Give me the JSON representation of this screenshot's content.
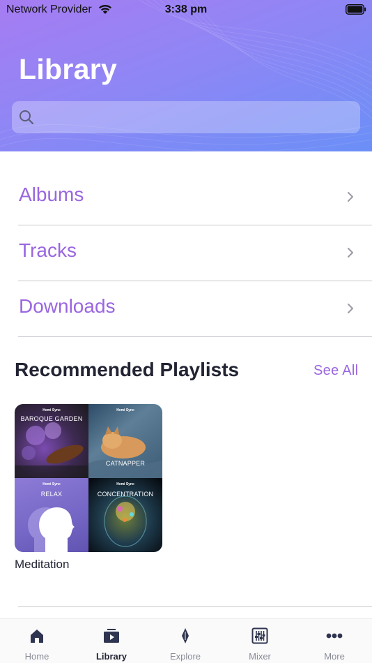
{
  "status_bar": {
    "carrier": "Network Provider",
    "time": "3:38 pm"
  },
  "header": {
    "title": "Library",
    "search_placeholder": ""
  },
  "library_items": [
    {
      "label": "Albums"
    },
    {
      "label": "Tracks"
    },
    {
      "label": "Downloads"
    }
  ],
  "recommended": {
    "title": "Recommended Playlists",
    "see_all": "See All",
    "playlists": [
      {
        "name": "Meditation",
        "cover_tiles": [
          {
            "brand": "Hemi Sync",
            "title": "BAROQUE GARDEN"
          },
          {
            "brand": "Hemi Sync",
            "title": "CATNAPPER"
          },
          {
            "brand": "Hemi Sync",
            "title": "RELAX"
          },
          {
            "brand": "Hemi Sync",
            "title": "CONCENTRATION"
          }
        ]
      }
    ]
  },
  "tab_bar": {
    "active": "Library",
    "tabs": [
      {
        "label": "Home",
        "icon": "house-icon"
      },
      {
        "label": "Library",
        "icon": "library-icon"
      },
      {
        "label": "Explore",
        "icon": "explore-icon"
      },
      {
        "label": "Mixer",
        "icon": "mixer-icon"
      },
      {
        "label": "More",
        "icon": "more-dots-icon"
      }
    ]
  },
  "colors": {
    "accent": "#9a66e0",
    "header_gradient_start": "#a67cf2",
    "header_gradient_end": "#6b8ff7",
    "text_dark": "#222433",
    "tab_inactive": "#8a8c96"
  }
}
